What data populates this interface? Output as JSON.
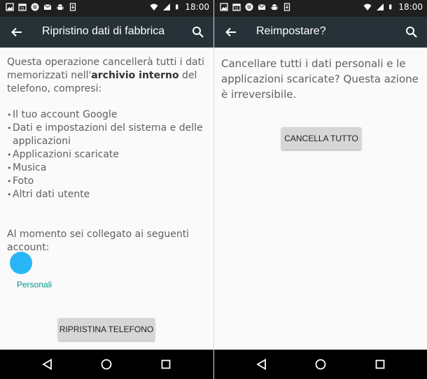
{
  "left_screen": {
    "status": {
      "time": "18:00"
    },
    "toolbar": {
      "title": "Ripristino dati di fabbrica"
    },
    "intro_prefix": "Questa operazione cancellerà tutti i dati memorizzati nell'",
    "intro_bold": "archivio interno",
    "intro_suffix": " del telefono, compresi:",
    "bullets": [
      "Il tuo account Google",
      "Dati e impostazioni del sistema e delle applicazioni",
      "Applicazioni scaricate",
      "Musica",
      "Foto",
      "Altri dati utente"
    ],
    "accounts_text": "Al momento sei collegato ai seguenti account:",
    "section_header": "Personali",
    "reset_button": "RIPRISTINA TELEFONO"
  },
  "right_screen": {
    "status": {
      "time": "18:00"
    },
    "toolbar": {
      "title": "Reimpostare?"
    },
    "message": "Cancellare tutti i dati personali e le applicazioni scaricate? Questa azione è irreversibile.",
    "erase_button": "CANCELLA TUTTO"
  },
  "icons": {
    "back": "arrow-left-icon",
    "search": "search-icon",
    "nav_back": "triangle-back-icon",
    "nav_home": "circle-home-icon",
    "nav_recent": "square-recent-icon"
  },
  "colors": {
    "toolbar": "#263238",
    "statusbar": "#1f1f1f",
    "accent": "#009688",
    "button": "#d6d6d6",
    "avatar": "#29b6f6"
  }
}
